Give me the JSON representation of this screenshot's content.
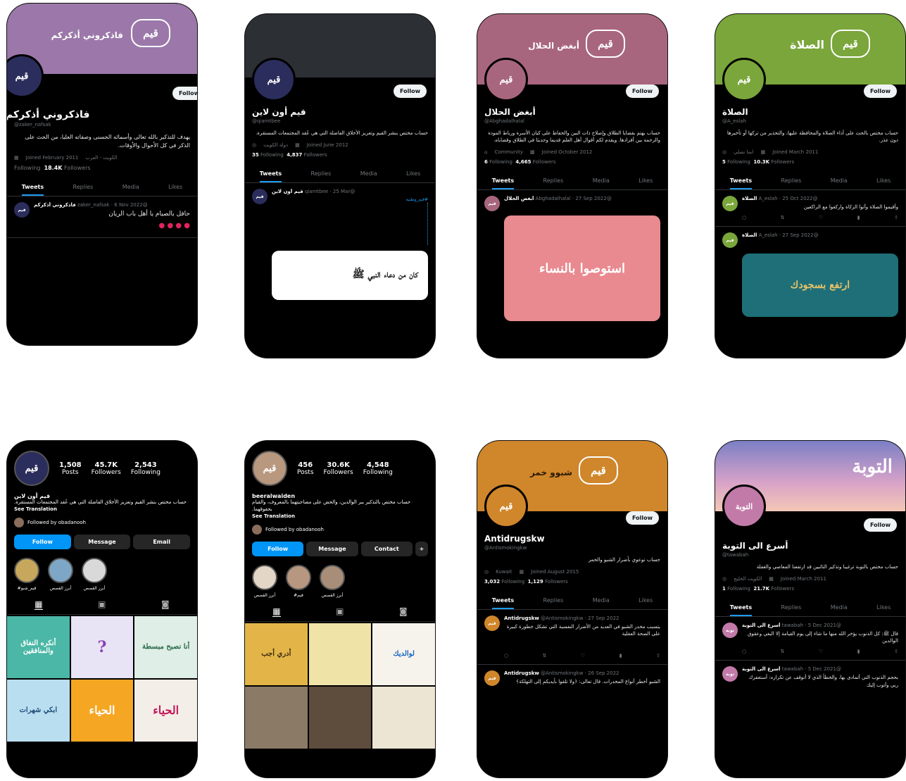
{
  "row1": [
    {
      "banner_text": "فاذكروني أذكركم",
      "follow": "Follow",
      "name": "فاذكروني أذكركم",
      "handle": "@zaker_nafsak",
      "bio": "يهدف للتذكير بالله تعالى وأسمائه الحسنى وصفاته العليا، من الحث على الذكر في كل الأحوال والأوقات.",
      "location": "الكويت - العرب",
      "joined": "Joined February 2011",
      "following": "Following",
      "followers_count": "18.4K",
      "followers_label": "Followers",
      "tabs": [
        "Tweets",
        "Replies",
        "Media",
        "Likes"
      ],
      "tweet_name": "فاذكروني أذكركم",
      "tweet_meta": "@zaker_nafsak · 6 Nov 2022",
      "tweet_text": "حافل بالصيام يا أهل باب الريان",
      "avatar_text": "قيم"
    },
    {
      "banner_text": "",
      "follow": "Follow",
      "name": "قيم أون لاين",
      "handle": "@qiamtbee",
      "bio": "حساب مختص بنشر القيم وتعزيز الأخلاق الفاضلة التي هي عُقد المجتمعات المستقرة.",
      "location": "دولة الكويت",
      "joined": "Joined June 2012",
      "following_count": "35",
      "following": "Following",
      "followers_count": "4,837",
      "followers_label": "Followers",
      "tabs": [
        "Tweets",
        "Replies",
        "Media",
        "Likes"
      ],
      "tweet_name": "قيم أون لاين",
      "tweet_meta": "@qiamtbee · 25 Mar",
      "tweet_text": "#قيم_وطنية",
      "media_text": "كان من دعاء النبي ﷺ",
      "avatar_text": "قيم"
    },
    {
      "banner_text": "أبغض الحلال",
      "follow": "Follow",
      "name": "أبغض الحلال",
      "handle": "@Abghadalhalal",
      "bio": "حساب يهتم بقضايا الطلاق وإصلاح ذات البين والحفاظ على كيان الأسرة ورباط المودة والرحمة بين أفرادها. ويقدم لكم أقوال أهل العلم قديما وحديثا في الطلاق وقضاياه.",
      "location": "Community",
      "joined": "Joined October 2012",
      "following_count": "6",
      "following": "Following",
      "followers_count": "4,665",
      "followers_label": "Followers",
      "tabs": [
        "Tweets",
        "Replies",
        "Media",
        "Likes"
      ],
      "tweet_name": "أبغض الحلال",
      "tweet_meta": "@Abghadalhalal · 27 Sep 2022",
      "media_text": "استوصوا بالنساء",
      "avatar_text": "قيم"
    },
    {
      "banner_text": "الصلاة",
      "follow": "Follow",
      "name": "الصلاة",
      "handle": "@A_eslah",
      "bio": "حساب مختص بالحث على أداء الصلاة والمحافظة عليها، والتحذير من تركها أو تأخيرها دون عذر.",
      "location": "انما تصلي",
      "joined": "Joined March 2011",
      "following_count": "5",
      "following": "Following",
      "followers_count": "10.3K",
      "followers_label": "Followers",
      "tabs": [
        "Tweets",
        "Replies",
        "Media",
        "Likes"
      ],
      "tweet_name": "الصلاة",
      "tweet_meta": "@A_eslah · 25 Oct 2022",
      "tweet_text": "وأقيموا الصلاة وآتوا الزكاة واركعوا مع الراكعين",
      "tweet2_meta": "@A_eslah · 27 Sep 2022",
      "media_text": "ارتفع بسجودك",
      "avatar_text": "قيم"
    }
  ],
  "row2": [
    {
      "posts": "1,508",
      "posts_label": "Posts",
      "followers": "45.7K",
      "followers_label": "Followers",
      "following": "2,543",
      "following_label": "Following",
      "name": "قيم أون لاين",
      "bio": "حساب مختص بنشر القيم وتعزيز الأخلاق الفاضلة التي هي عُقد المجتمعات المستقرة.",
      "see": "See Translation",
      "followed_by": "Followed by obadanooh",
      "btn_follow": "Follow",
      "btn_message": "Message",
      "btn_third": "Email",
      "highlights": [
        "#قيم_شبو",
        "أبرز القصص",
        "أبرز القصص"
      ],
      "cells": [
        "أنكره النفاق والمنافقين",
        "?",
        "أنا نصبح مبسطة",
        "ابكي شهرات",
        "الحياء",
        "الحياء"
      ]
    },
    {
      "posts": "456",
      "posts_label": "Posts",
      "followers": "30.6K",
      "followers_label": "Followers",
      "following": "4,548",
      "following_label": "Following",
      "name": "beeralwaiden",
      "bio": "حساب مختص بالتذكير ببر الوالدين، والحض على مصاحبتهما بالمعروف، والقيام بحقوقهما.",
      "see": "See Translation",
      "followed_by": "Followed by obadanooh",
      "btn_follow": "Follow",
      "btn_message": "Message",
      "btn_third": "Contact",
      "highlights": [
        "أبرز القصص",
        "#قيم",
        "أبرز القصص"
      ],
      "cells": [
        "أدري أجب",
        "",
        "لوالديك",
        "",
        "",
        ""
      ]
    },
    {
      "banner_text": "شبوو خمر",
      "follow": "Follow",
      "name": "Antidrugskw",
      "handle": "@Antismokingkw",
      "bio": "حساب توعوي بأضرار الشبو والخمر",
      "location": "Kuwait",
      "joined": "Joined August 2015",
      "following_count": "3,032",
      "following": "Following",
      "followers_count": "1,129",
      "followers_label": "Followers",
      "tabs": [
        "Tweets",
        "Replies",
        "Media",
        "Likes"
      ],
      "tweet_name": "Antidrugskw",
      "tweet_meta": "@Antismokingkw · 27 Sep 2022",
      "tweet_text": "يتسبب مخدر الشبو في العديد من الأضرار النفسية التي تشكل خطورة كبيرة على الصحة العقلية",
      "tweet2_meta": "@Antismokingkw · 26 Sep 2022",
      "tweet2_text": "الشبو أخطر أنواع المخدرات. قال تعالى: ﴿ولا تلقوا بأيديكم إلى التهلكة﴾",
      "avatar_text": "قيم"
    },
    {
      "banner_text": "التوبة",
      "follow": "Follow",
      "name": "أسرع الى التوبة",
      "handle": "@tawabah",
      "bio": "حساب مختص بالتوبة ترغيبا وتذكير التائبين قد ارتفعنا المعاصي والغفلة",
      "location": "الكويت الخليج",
      "joined": "Joined March 2011",
      "following_count": "1",
      "following": "Following",
      "followers_count": "21.7K",
      "followers_label": "Followers",
      "tabs": [
        "Tweets",
        "Replies",
        "Media",
        "Likes"
      ],
      "tweet_name": "أسرع الى التوبة",
      "tweet_meta": "@tawabah · 5 Dec 2021",
      "tweet_text": "قال ﷺ: كل الذنوب يؤخر الله منها ما شاء إلى يوم القيامة إلا البغي وعقوق الوالدين",
      "tweet2_meta": "@tawabah · 5 Dec 2021",
      "tweet2_text": "بحجم الذنوب التي أتمادى بها، والخطأ الذي لا أتوقف عن تكراره: أستغفرك ربي وأتوب إليك",
      "avatar_text": "التوبة"
    }
  ],
  "colors": {
    "purple": "#9b78a9",
    "dark": "#2c2f33",
    "mauve": "#a8667e",
    "green": "#7aa63b",
    "orange": "#d0862b",
    "blue": "#1d9bf0"
  }
}
